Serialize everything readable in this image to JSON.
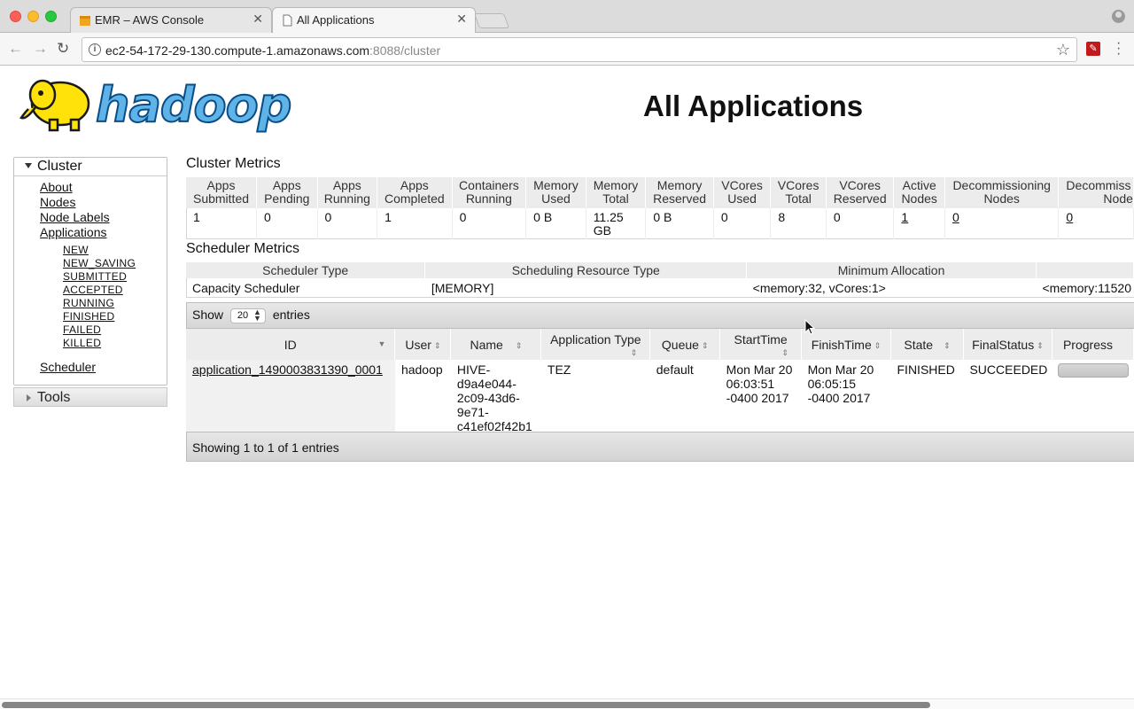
{
  "browser": {
    "tabs": [
      {
        "title": "EMR – AWS Console",
        "active": false,
        "icon": "aws-box-icon"
      },
      {
        "title": "All Applications",
        "active": true,
        "icon": "page-icon"
      }
    ],
    "url_host": "ec2-54-172-29-130.compute-1.amazonaws.com",
    "url_path": ":8088/cluster",
    "close_glyph": "✕",
    "pdf_glyph": "✎"
  },
  "page": {
    "title": "All Applications",
    "logo_text_a": "had",
    "logo_text_b": "oop"
  },
  "sidebar": {
    "cluster_label": "Cluster",
    "links": [
      "About",
      "Nodes",
      "Node Labels",
      "Applications"
    ],
    "app_states": [
      "NEW",
      "NEW_SAVING",
      "SUBMITTED",
      "ACCEPTED",
      "RUNNING",
      "FINISHED",
      "FAILED",
      "KILLED"
    ],
    "scheduler_label": "Scheduler",
    "tools_label": "Tools"
  },
  "cluster_metrics": {
    "title": "Cluster Metrics",
    "headers": [
      [
        "Apps",
        "Submitted"
      ],
      [
        "Apps",
        "Pending"
      ],
      [
        "Apps",
        "Running"
      ],
      [
        "Apps",
        "Completed"
      ],
      [
        "Containers",
        "Running"
      ],
      [
        "Memory",
        "Used"
      ],
      [
        "Memory",
        "Total"
      ],
      [
        "Memory",
        "Reserved"
      ],
      [
        "VCores",
        "Used"
      ],
      [
        "VCores",
        "Total"
      ],
      [
        "VCores",
        "Reserved"
      ],
      [
        "Active",
        "Nodes"
      ],
      [
        "Decommissioning",
        "Nodes"
      ],
      [
        "Decommiss",
        "Node"
      ]
    ],
    "values": [
      "1",
      "0",
      "0",
      "1",
      "0",
      "0 B",
      "11.25 GB",
      "0 B",
      "0",
      "8",
      "0",
      "1",
      "0",
      "0"
    ]
  },
  "scheduler_metrics": {
    "title": "Scheduler Metrics",
    "headers": [
      "Scheduler Type",
      "Scheduling Resource Type",
      "Minimum Allocation",
      ""
    ],
    "values": [
      "Capacity Scheduler",
      "[MEMORY]",
      "<memory:32, vCores:1>",
      "<memory:11520"
    ]
  },
  "apps_table": {
    "show_label": "Show",
    "entries_label": "entries",
    "page_length": "20",
    "headers": [
      "ID",
      "User",
      "Name",
      "Application Type",
      "Queue",
      "StartTime",
      "FinishTime",
      "State",
      "FinalStatus",
      "Progress"
    ],
    "rows": [
      {
        "id": "application_1490003831390_0001",
        "user": "hadoop",
        "name": "HIVE-d9a4e044-2c09-43d6-9e71-c41ef02f42b1",
        "name_lines": [
          "HIVE-",
          "d9a4e044-",
          "2c09-43d6-",
          "9e71-",
          "c41ef02f42b1"
        ],
        "app_type": "TEZ",
        "queue": "default",
        "start_lines": [
          "Mon Mar 20",
          "06:03:51",
          "-0400 2017"
        ],
        "finish_lines": [
          "Mon Mar 20",
          "06:05:15",
          "-0400 2017"
        ],
        "state": "FINISHED",
        "final_status": "SUCCEEDED"
      }
    ],
    "footer": "Showing 1 to 1 of 1 entries"
  }
}
